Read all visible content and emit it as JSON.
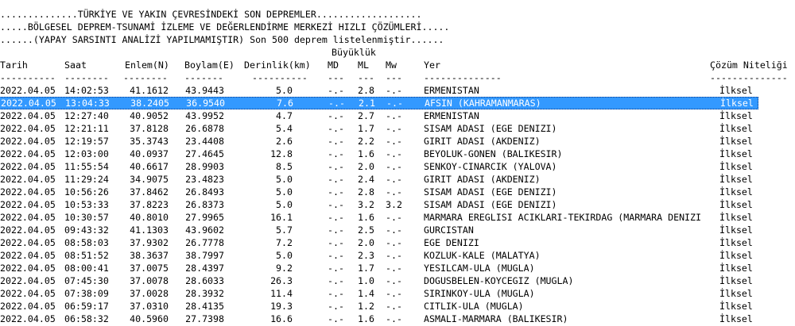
{
  "header": {
    "line1": "..............TÜRKİYE VE YAKIN ÇEVRESİNDEKİ SON DEPREMLER...................",
    "line2": ".....BÖLGESEL DEPREM-TSUNAMİ İZLEME VE DEĞERLENDİRME MERKEZİ HIZLI ÇÖZÜMLERİ.....",
    "line3": "......(YAPAY SARSINTI ANALİZİ YAPILMAMIŞTIR) Son 500 deprem listelenmiştir......"
  },
  "columns": {
    "buyukluk": "Büyüklük",
    "tarih": "Tarih",
    "saat": "Saat",
    "enlem": "Enlem(N)",
    "boylam": "Boylam(E)",
    "derinlik": "Derinlik(km)",
    "md": "MD",
    "ml": "ML",
    "mw": "Mw",
    "yer": "Yer",
    "cozum": "Çözüm Niteliği"
  },
  "separators": {
    "tarih": "----------",
    "saat": "--------",
    "enlem": "--------",
    "boylam": "-------",
    "derinlik": "----------",
    "md": "---",
    "ml": "---",
    "mw": "---",
    "yer": "--------------",
    "cozum": "--------------"
  },
  "rows": [
    {
      "tarih": "2022.04.05",
      "saat": "14:02:53",
      "enlem": "41.1612",
      "boylam": "43.9443",
      "derinlik": "5.0",
      "md": "-.-",
      "ml": "2.8",
      "mw": "-.-",
      "yer": "ERMENISTAN",
      "cozum": "İlksel"
    },
    {
      "tarih": "2022.04.05",
      "saat": "13:04:33",
      "enlem": "38.2405",
      "boylam": "36.9540",
      "derinlik": "7.6",
      "md": "-.-",
      "ml": "2.1",
      "mw": "-.-",
      "yer": "AFSIN (KAHRAMANMARAS)",
      "cozum": "İlksel",
      "selected": true
    },
    {
      "tarih": "2022.04.05",
      "saat": "12:27:40",
      "enlem": "40.9052",
      "boylam": "43.9952",
      "derinlik": "4.7",
      "md": "-.-",
      "ml": "2.7",
      "mw": "-.-",
      "yer": "ERMENISTAN",
      "cozum": "İlksel"
    },
    {
      "tarih": "2022.04.05",
      "saat": "12:21:11",
      "enlem": "37.8128",
      "boylam": "26.6878",
      "derinlik": "5.4",
      "md": "-.-",
      "ml": "1.7",
      "mw": "-.-",
      "yer": "SISAM ADASI (EGE DENIZI)",
      "cozum": "İlksel"
    },
    {
      "tarih": "2022.04.05",
      "saat": "12:19:57",
      "enlem": "35.3743",
      "boylam": "23.4408",
      "derinlik": "2.6",
      "md": "-.-",
      "ml": "2.2",
      "mw": "-.-",
      "yer": "GIRIT ADASI (AKDENIZ)",
      "cozum": "İlksel"
    },
    {
      "tarih": "2022.04.05",
      "saat": "12:03:00",
      "enlem": "40.0937",
      "boylam": "27.4645",
      "derinlik": "12.8",
      "md": "-.-",
      "ml": "1.6",
      "mw": "-.-",
      "yer": "BEYOLUK-GONEN (BALIKESIR)",
      "cozum": "İlksel"
    },
    {
      "tarih": "2022.04.05",
      "saat": "11:55:54",
      "enlem": "40.6617",
      "boylam": "28.9903",
      "derinlik": "8.5",
      "md": "-.-",
      "ml": "2.0",
      "mw": "-.-",
      "yer": "SENKOY-CINARCIK (YALOVA)",
      "cozum": "İlksel"
    },
    {
      "tarih": "2022.04.05",
      "saat": "11:29:24",
      "enlem": "34.9075",
      "boylam": "23.4823",
      "derinlik": "5.0",
      "md": "-.-",
      "ml": "2.4",
      "mw": "-.-",
      "yer": "GIRIT ADASI (AKDENIZ)",
      "cozum": "İlksel"
    },
    {
      "tarih": "2022.04.05",
      "saat": "10:56:26",
      "enlem": "37.8462",
      "boylam": "26.8493",
      "derinlik": "5.0",
      "md": "-.-",
      "ml": "2.8",
      "mw": "-.-",
      "yer": "SISAM ADASI (EGE DENIZI)",
      "cozum": "İlksel"
    },
    {
      "tarih": "2022.04.05",
      "saat": "10:53:33",
      "enlem": "37.8223",
      "boylam": "26.8373",
      "derinlik": "5.0",
      "md": "-.-",
      "ml": "3.2",
      "mw": "3.2",
      "yer": "SISAM ADASI (EGE DENIZI)",
      "cozum": "İlksel"
    },
    {
      "tarih": "2022.04.05",
      "saat": "10:30:57",
      "enlem": "40.8010",
      "boylam": "27.9965",
      "derinlik": "16.1",
      "md": "-.-",
      "ml": "1.6",
      "mw": "-.-",
      "yer": "MARMARA EREGLISI ACIKLARI-TEKIRDAG (MARMARA DENIZI",
      "cozum": "İlksel"
    },
    {
      "tarih": "2022.04.05",
      "saat": "09:43:32",
      "enlem": "41.1303",
      "boylam": "43.9602",
      "derinlik": "5.7",
      "md": "-.-",
      "ml": "2.5",
      "mw": "-.-",
      "yer": "GURCISTAN",
      "cozum": "İlksel"
    },
    {
      "tarih": "2022.04.05",
      "saat": "08:58:03",
      "enlem": "37.9302",
      "boylam": "26.7778",
      "derinlik": "7.2",
      "md": "-.-",
      "ml": "2.0",
      "mw": "-.-",
      "yer": "EGE DENIZI",
      "cozum": "İlksel"
    },
    {
      "tarih": "2022.04.05",
      "saat": "08:51:52",
      "enlem": "38.3637",
      "boylam": "38.7997",
      "derinlik": "5.0",
      "md": "-.-",
      "ml": "2.3",
      "mw": "-.-",
      "yer": "KOZLUK-KALE (MALATYA)",
      "cozum": "İlksel"
    },
    {
      "tarih": "2022.04.05",
      "saat": "08:00:41",
      "enlem": "37.0075",
      "boylam": "28.4397",
      "derinlik": "9.2",
      "md": "-.-",
      "ml": "1.7",
      "mw": "-.-",
      "yer": "YESILCAM-ULA (MUGLA)",
      "cozum": "İlksel"
    },
    {
      "tarih": "2022.04.05",
      "saat": "07:45:30",
      "enlem": "37.0078",
      "boylam": "28.6033",
      "derinlik": "26.3",
      "md": "-.-",
      "ml": "1.0",
      "mw": "-.-",
      "yer": "DOGUSBELEN-KOYCEGIZ (MUGLA)",
      "cozum": "İlksel"
    },
    {
      "tarih": "2022.04.05",
      "saat": "07:38:09",
      "enlem": "37.0028",
      "boylam": "28.3932",
      "derinlik": "11.4",
      "md": "-.-",
      "ml": "1.4",
      "mw": "-.-",
      "yer": "SIRINKOY-ULA (MUGLA)",
      "cozum": "İlksel"
    },
    {
      "tarih": "2022.04.05",
      "saat": "06:59:17",
      "enlem": "37.0310",
      "boylam": "28.4135",
      "derinlik": "19.3",
      "md": "-.-",
      "ml": "1.2",
      "mw": "-.-",
      "yer": "CITLIK-ULA (MUGLA)",
      "cozum": "İlksel"
    },
    {
      "tarih": "2022.04.05",
      "saat": "06:58:32",
      "enlem": "40.5960",
      "boylam": "27.7398",
      "derinlik": "16.6",
      "md": "-.-",
      "ml": "1.6",
      "mw": "-.-",
      "yer": "ASMALI-MARMARA (BALIKESIR)",
      "cozum": "İlksel"
    }
  ]
}
